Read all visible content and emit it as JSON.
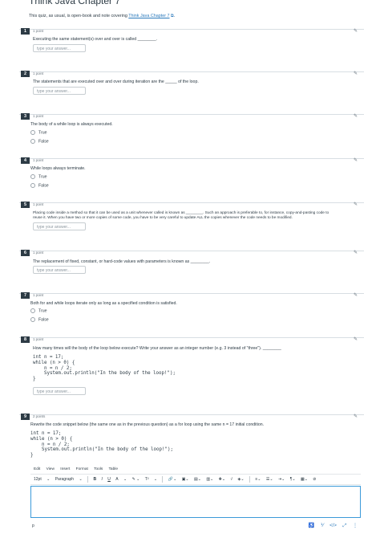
{
  "header": {
    "title": "Think Java Chapter 7",
    "intro_text": "This quiz, as usual, is open-book and note covering ",
    "intro_link": "Think Java Chapter 7",
    "intro_end": "."
  },
  "questions": [
    {
      "number": "1",
      "points": "1 point",
      "prompt": "Executing the same statement(s) over and over is called ________.",
      "type": "fill",
      "placeholder": "type your answer..."
    },
    {
      "number": "2",
      "points": "1 point",
      "prompt": "The statements that are executed over and over during iteration are the _____ of the loop.",
      "type": "fill",
      "placeholder": "type your answer..."
    },
    {
      "number": "3",
      "points": "1 point",
      "prompt": "The body of a while loop is always executed.",
      "type": "tf",
      "choices": [
        "True",
        "False"
      ]
    },
    {
      "number": "4",
      "points": "1 point",
      "prompt": "While loops always terminate.",
      "type": "tf",
      "choices": [
        "True",
        "False"
      ]
    },
    {
      "number": "5",
      "points": "1 point",
      "prompt_line1": "Placing code inside a method so that it can be used as a unit whenever called is known as ________. Such an approach is preferable to, for instance, copy-and-pasting code to",
      "prompt_line2": "reuse it. When you have two or more copies of some code, you have to be very careful to update ALL the copies whenever the code needs to be modified.",
      "type": "fill",
      "placeholder": "type your answer..."
    },
    {
      "number": "6",
      "points": "1 point",
      "prompt": "The replacement of fixed, constant, or hard-code values with parameters is known as ________.",
      "type": "fill",
      "placeholder": "type your answer..."
    },
    {
      "number": "7",
      "points": "1 point",
      "prompt": "Both for and while loops iterate only as long as a specified condition is satisfied.",
      "type": "tf",
      "choices": [
        "True",
        "False"
      ]
    },
    {
      "number": "8",
      "points": "1 point",
      "prompt": "How many times will the body of the loop below execute? Write your answer as an integer number (e.g. 3 instead of \"three\"). ________",
      "code": [
        "int n = 17;",
        "while (n > 0) {",
        "    n = n / 2;",
        "    System.out.println(\"In the body of the loop!\");",
        "}"
      ],
      "type": "fill",
      "placeholder": "type your answer..."
    },
    {
      "number": "9",
      "points": "2 points",
      "prompt": "Rewrite the code snippet below (the same one as in the previous question) as a for loop using the same n = 17 initial condition.",
      "code": [
        "int n = 17;",
        "while (n > 0) {",
        "    n = n / 2;",
        "    System.out.println(\"In the body of the loop!\");",
        "}"
      ],
      "type": "essay"
    }
  ],
  "editor": {
    "menu": [
      "Edit",
      "View",
      "Insert",
      "Format",
      "Tools",
      "Table"
    ],
    "font_size": "12pt",
    "paragraph": "Paragraph",
    "bold": "B",
    "italic": "I",
    "underline": "U",
    "text_color": "A",
    "superscript": "T²",
    "status_path": "p",
    "code_view": "</>",
    "word_icon": "⅟"
  },
  "icons": {
    "pin": "pin-icon",
    "external_link": "external-link-icon"
  },
  "colors": {
    "accent": "#2b7abc",
    "number_badge": "#2d3b45",
    "editor_border": "#3b9ad9"
  }
}
